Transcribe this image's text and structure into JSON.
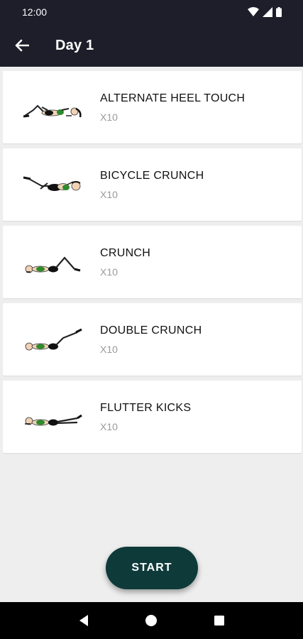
{
  "status_bar": {
    "time": "12:00"
  },
  "app_bar": {
    "title": "Day 1"
  },
  "exercises": [
    {
      "name": "ALTERNATE HEEL TOUCH",
      "reps": "X10",
      "icon": "heel-touch-figure"
    },
    {
      "name": "BICYCLE CRUNCH",
      "reps": "X10",
      "icon": "bicycle-crunch-figure"
    },
    {
      "name": "CRUNCH",
      "reps": "X10",
      "icon": "crunch-figure"
    },
    {
      "name": "DOUBLE CRUNCH",
      "reps": "X10",
      "icon": "double-crunch-figure"
    },
    {
      "name": "FLUTTER KICKS",
      "reps": "X10",
      "icon": "flutter-kicks-figure"
    }
  ],
  "start_button": {
    "label": "START"
  },
  "colors": {
    "app_bar": "#1e1e2a",
    "start_button": "#0e3b3a",
    "background": "#eeeeee",
    "figure_accent": "#2e8b2e"
  }
}
